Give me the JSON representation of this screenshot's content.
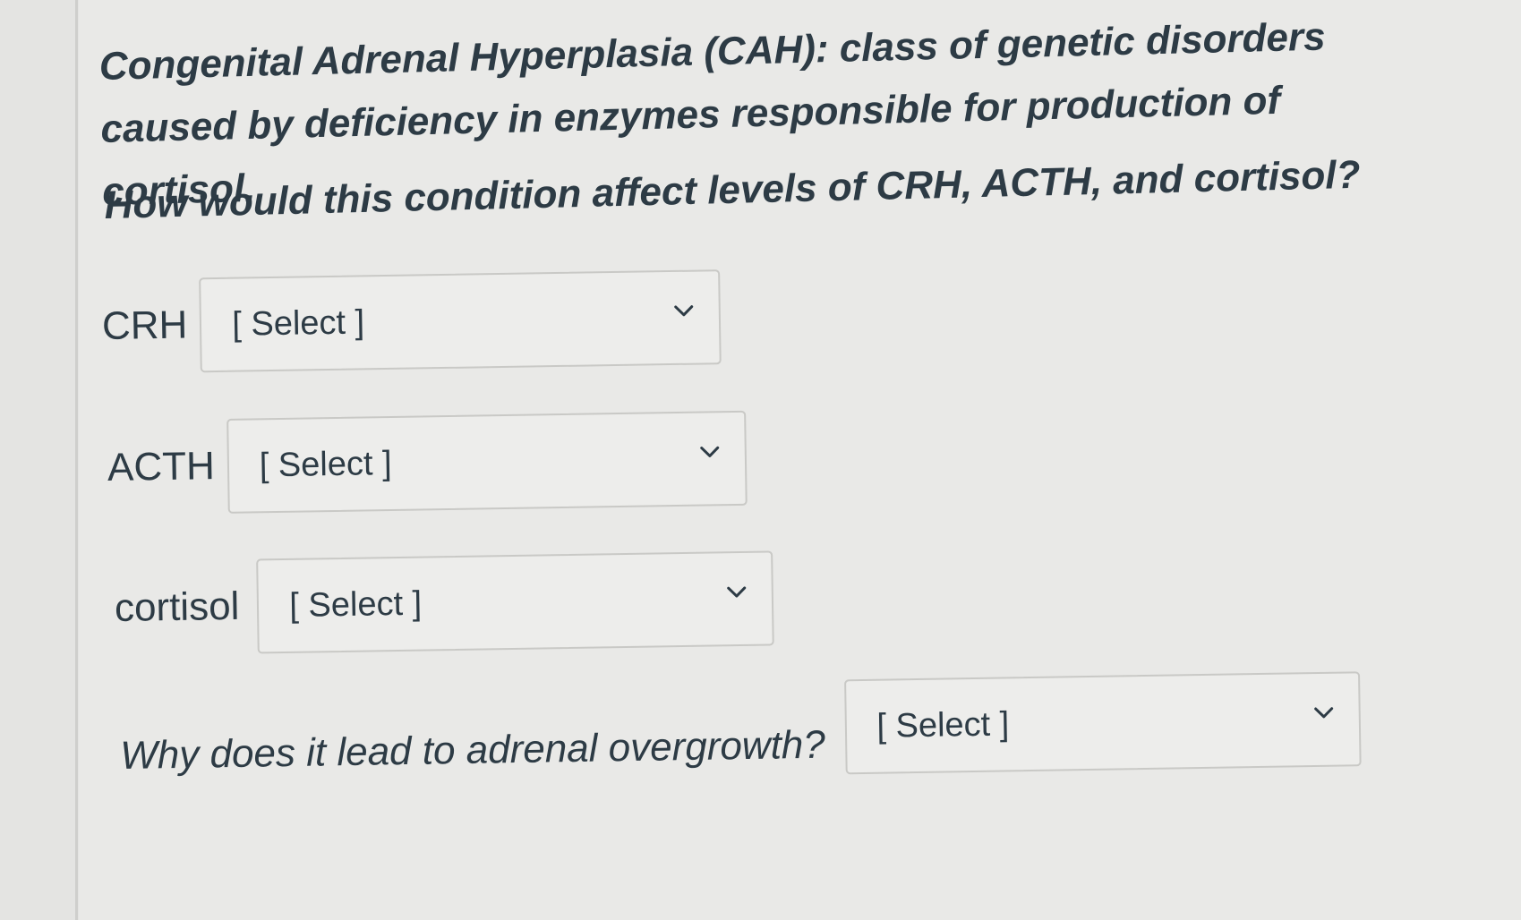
{
  "intro": "Congenital Adrenal Hyperplasia (CAH): class of genetic disorders caused by deficiency in enzymes responsible for production of cortisol.",
  "question": "How would this condition affect levels of CRH, ACTH, and cortisol?",
  "dropdowns": [
    {
      "label": "CRH",
      "selected": "[ Select ]",
      "icon": "chevron-down-icon"
    },
    {
      "label": "ACTH",
      "selected": "[ Select ]",
      "icon": "chevron-down-icon"
    },
    {
      "label": "cortisol",
      "selected": "[ Select ]",
      "icon": "chevron-down-icon"
    },
    {
      "label": "Why does it lead to adrenal overgrowth?",
      "selected": "[ Select ]",
      "icon": "chevron-down-icon"
    }
  ]
}
